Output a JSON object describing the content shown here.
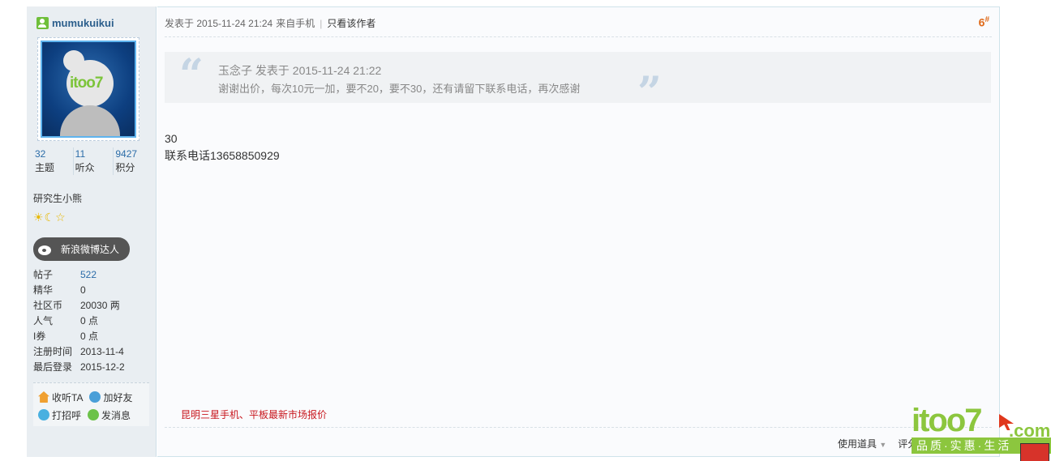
{
  "user": {
    "name": "mumukuikui",
    "avatar_logo": "itoo7",
    "stats": [
      {
        "value": "32",
        "label": "主题"
      },
      {
        "value": "11",
        "label": "听众"
      },
      {
        "value": "9427",
        "label": "积分"
      }
    ],
    "rank_title": "研究生小熊",
    "rank_icons": [
      "sun-icon",
      "moon-icon",
      "star-icon"
    ],
    "badge_label": "新浪微博达人",
    "info": [
      {
        "key": "帖子",
        "value": "522"
      },
      {
        "key": "精华",
        "value": "0"
      },
      {
        "key": "社区币",
        "value": "20030 两"
      },
      {
        "key": "人气",
        "value": "0 点"
      },
      {
        "key": "I券",
        "value": "0 点"
      },
      {
        "key": "注册时间",
        "value": "2013-11-4"
      },
      {
        "key": "最后登录",
        "value": "2015-12-2"
      }
    ],
    "actions": {
      "follow": "收听TA",
      "add_friend": "加好友",
      "greet": "打招呼",
      "message": "发消息"
    }
  },
  "post": {
    "posted_at": "发表于 2015-11-24 21:24",
    "source": "来自手机",
    "only_author": "只看该作者",
    "floor": "6",
    "floor_mark": "#",
    "quote": {
      "meta": "玉念子 发表于 2015-11-24 21:22",
      "text": "谢谢出价，每次10元一加，要不20，要不30，还有请留下联系电话，再次感谢"
    },
    "content_lines": [
      "30",
      "联系电话13658850929"
    ],
    "ad_link": "昆明三星手机、平板最新市场报价",
    "tools": {
      "use_tool": "使用道具",
      "rate": "评分"
    }
  },
  "brand": {
    "logo_main": "itoo7",
    "logo_suffix": ".com",
    "slogan": "品质·实惠·生活"
  },
  "colors": {
    "link": "#2b6ca8",
    "floor": "#e06a1a",
    "ad": "#c8161d",
    "brand_green": "#8cc63e"
  }
}
